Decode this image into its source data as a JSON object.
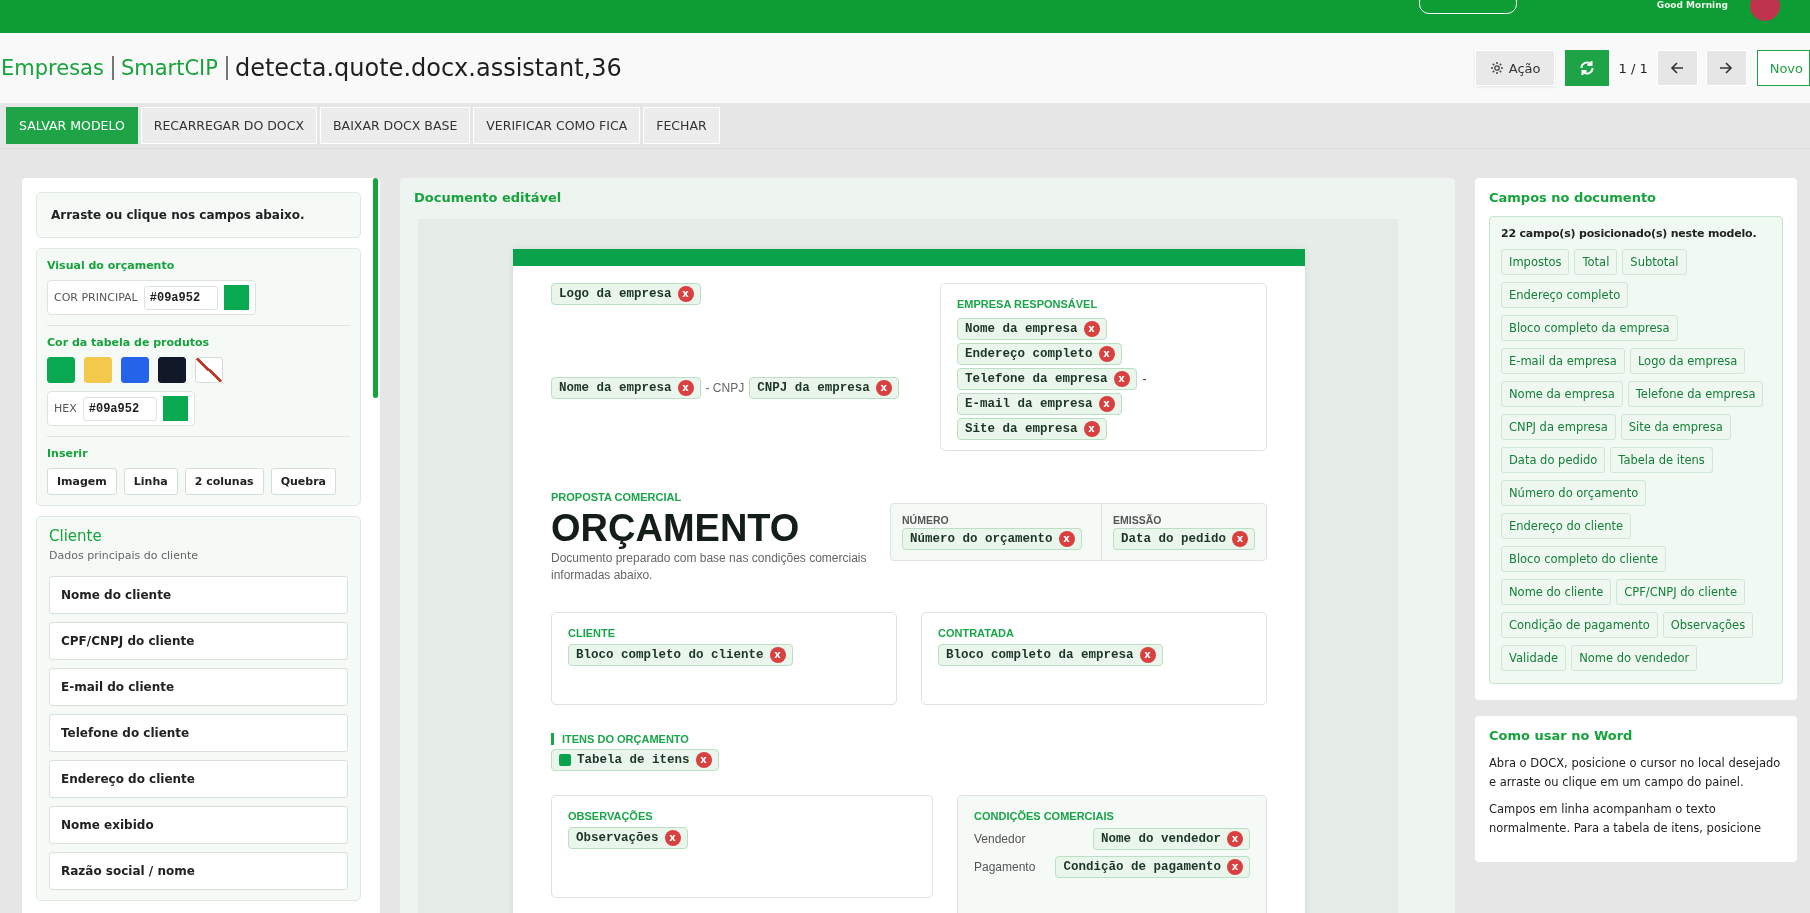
{
  "topbar": {
    "greeting": "Good Morning"
  },
  "header": {
    "breadcrumbs": [
      "Empresas",
      "SmartCIP"
    ],
    "title": "detecta.quote.docx.assistant,36",
    "action_button": "Ação",
    "pager": "1 / 1",
    "new_button": "Novo"
  },
  "toolbar": {
    "buttons": [
      {
        "label": "SALVAR MODELO",
        "kind": "primary"
      },
      {
        "label": "RECARREGAR DO DOCX",
        "kind": "default"
      },
      {
        "label": "BAIXAR DOCX BASE",
        "kind": "default"
      },
      {
        "label": "VERIFICAR COMO FICA",
        "kind": "default"
      },
      {
        "label": "FECHAR",
        "kind": "default"
      }
    ]
  },
  "left_panel": {
    "hint": "Arraste ou clique nos campos abaixo.",
    "visual": {
      "title": "Visual do orçamento",
      "main_color": {
        "label": "COR PRINCIPAL",
        "value": "#09a952"
      },
      "table_color_title": "Cor da tabela de produtos",
      "swatches": [
        {
          "kind": "color",
          "color": "#09a952"
        },
        {
          "kind": "color",
          "color": "#f2c94c"
        },
        {
          "kind": "color",
          "color": "#2563eb"
        },
        {
          "kind": "color",
          "color": "#111827"
        },
        {
          "kind": "none"
        }
      ],
      "hex": {
        "label": "HEX",
        "value": "#09a952"
      },
      "insert_title": "Inserir",
      "insert_buttons": [
        "Imagem",
        "Linha",
        "2 colunas",
        "Quebra"
      ]
    },
    "client": {
      "title": "Cliente",
      "subtitle": "Dados principais do cliente",
      "fields": [
        "Nome do cliente",
        "CPF/CNPJ do cliente",
        "E-mail do cliente",
        "Telefone do cliente",
        "Endereço do cliente",
        "Nome exibido",
        "Razão social / nome"
      ]
    }
  },
  "document": {
    "title": "Documento editável",
    "logo_chip": {
      "label": "Logo da empresa",
      "remove": "x"
    },
    "company_line": {
      "name_chip": {
        "label": "Nome da empresa",
        "remove": "x"
      },
      "separator": "- CNPJ",
      "cnpj_chip": {
        "label": "CNPJ da empresa",
        "remove": "x"
      }
    },
    "company_box": {
      "label": "EMPRESA RESPONSÁVEL",
      "chips": [
        {
          "label": "Nome da empresa",
          "remove": "x"
        },
        {
          "label": "Endereço completo",
          "remove": "x"
        },
        {
          "label": "Telefone da empresa",
          "remove": "x",
          "suffix": "-"
        },
        {
          "label": "E-mail da empresa",
          "remove": "x"
        },
        {
          "label": "Site da empresa",
          "remove": "x"
        }
      ]
    },
    "proposal": {
      "eyebrow": "PROPOSTA COMERCIAL",
      "title": "ORÇAMENTO",
      "description": "Documento preparado com base nas condições comerciais informadas abaixo."
    },
    "meta": [
      {
        "label": "NÚMERO",
        "chip": {
          "label": "Número do orçamento",
          "remove": "x"
        }
      },
      {
        "label": "EMISSÃO",
        "chip": {
          "label": "Data do pedido",
          "remove": "x"
        }
      }
    ],
    "parties": [
      {
        "label": "CLIENTE",
        "chip": {
          "label": "Bloco completo do cliente",
          "remove": "x"
        }
      },
      {
        "label": "CONTRATADA",
        "chip": {
          "label": "Bloco completo da empresa",
          "remove": "x"
        }
      }
    ],
    "items": {
      "label": "ITENS DO ORÇAMENTO",
      "chip": {
        "label": "Tabela de itens",
        "remove": "x",
        "kind": "table"
      }
    },
    "observations": {
      "label": "OBSERVAÇÕES",
      "chip": {
        "label": "Observações",
        "remove": "x"
      }
    },
    "conditions": {
      "label": "CONDIÇÕES COMERCIAIS",
      "rows": [
        {
          "label": "Vendedor",
          "chip": {
            "label": "Nome do vendedor",
            "remove": "x"
          }
        },
        {
          "label": "Pagamento",
          "chip": {
            "label": "Condição de pagamento",
            "remove": "x"
          }
        }
      ]
    }
  },
  "right_panel": {
    "fields_title": "Campos no documento",
    "summary": "22 campo(s) posicionado(s) neste modelo.",
    "tags": [
      "Impostos",
      "Total",
      "Subtotal",
      "Endereço completo",
      "Bloco completo da empresa",
      "E-mail da empresa",
      "Logo da empresa",
      "Nome da empresa",
      "Telefone da empresa",
      "CNPJ da empresa",
      "Site da empresa",
      "Data do pedido",
      "Tabela de itens",
      "Número do orçamento",
      "Endereço do cliente",
      "Bloco completo do cliente",
      "Nome do cliente",
      "CPF/CNPJ do cliente",
      "Condição de pagamento",
      "Observações",
      "Validade",
      "Nome do vendedor"
    ],
    "help_title": "Como usar no Word",
    "help_paragraphs": [
      "Abra o DOCX, posicione o cursor no local desejado e arraste ou clique em um campo do painel.",
      "Campos em linha acompanham o texto normalmente. Para a tabela de itens, posicione"
    ]
  }
}
